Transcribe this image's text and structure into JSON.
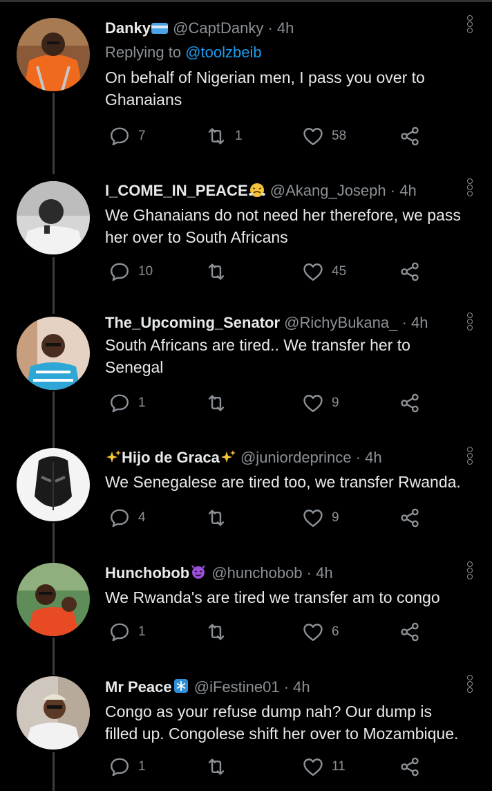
{
  "tweets": [
    {
      "name": "Danky",
      "name_emoji": "card-emoji",
      "handle": "@CaptDanky",
      "sep": "·",
      "time": "4h",
      "replying_prefix": "Replying to",
      "replying_to": "@toolzbeib",
      "text": "On behalf of Nigerian men, I pass you over to Ghanaians",
      "replies": "7",
      "retweets": "1",
      "likes": "58"
    },
    {
      "name": "I_COME_IN_PEACE",
      "name_emoji": "steam-face-emoji",
      "handle": "@Akang_Joseph",
      "sep": "·",
      "time": "4h",
      "text": "We Ghanaians do not need her therefore, we pass her over to South Africans",
      "replies": "10",
      "retweets": "",
      "likes": "45"
    },
    {
      "name": "The_Upcoming_Senator",
      "handle": "@RichyBukana_",
      "sep": "·",
      "time": "4h",
      "text": "South Africans are tired.. We transfer her to Senegal",
      "replies": "1",
      "retweets": "",
      "likes": "9"
    },
    {
      "name": "Hijo de Graca",
      "name_emoji": "sparkles-emoji",
      "handle": "@juniordeprince",
      "sep": "·",
      "time": "4h",
      "text": "We Senegalese are tired too, we transfer Rwanda.",
      "replies": "4",
      "retweets": "",
      "likes": "9"
    },
    {
      "name": "Hunchobob",
      "name_emoji": "devil-emoji",
      "handle": "@hunchobob",
      "sep": "·",
      "time": "4h",
      "text": "We Rwanda's are tired we transfer am to congo",
      "replies": "1",
      "retweets": "",
      "likes": "6"
    },
    {
      "name": "Mr Peace",
      "name_emoji": "snowflake-emoji",
      "handle": "@iFestine01",
      "sep": "·",
      "time": "4h",
      "text": "Congo as your refuse dump nah? Our dump is filled up. Congolese shift her over to Mozambique.",
      "replies": "1",
      "retweets": "",
      "likes": "11"
    }
  ],
  "colors": {
    "background": "#000000",
    "text": "#e7e9ea",
    "secondary": "#8b9196",
    "link": "#1d9bf0",
    "thread_line": "#3a3d41"
  },
  "icons": [
    "reply-icon",
    "retweet-icon",
    "like-icon",
    "share-icon",
    "more-options-icon"
  ]
}
